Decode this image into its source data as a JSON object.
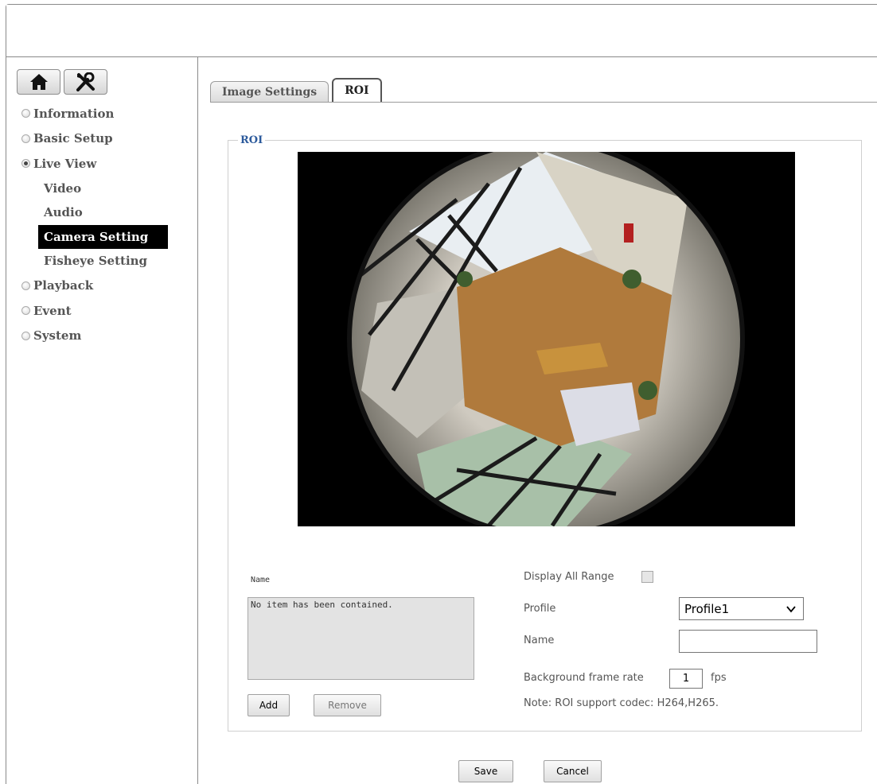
{
  "sidebar": {
    "toolbar": {
      "home_icon": "home-icon",
      "tools_icon": "tools-icon"
    },
    "menu": [
      {
        "label": "Information",
        "active": false
      },
      {
        "label": "Basic Setup",
        "active": false
      },
      {
        "label": "Live View",
        "active": true,
        "children": [
          {
            "label": "Video",
            "selected": false
          },
          {
            "label": "Audio",
            "selected": false
          },
          {
            "label": "Camera Setting",
            "selected": true
          },
          {
            "label": "Fisheye Setting",
            "selected": false
          }
        ]
      },
      {
        "label": "Playback",
        "active": false
      },
      {
        "label": "Event",
        "active": false
      },
      {
        "label": "System",
        "active": false
      }
    ]
  },
  "tabs": [
    {
      "label": "Image Settings",
      "active": false
    },
    {
      "label": "ROI",
      "active": true
    }
  ],
  "roi": {
    "legend": "ROI",
    "name_list_label": "Name",
    "name_list_empty": "No item has been contained.",
    "add_label": "Add",
    "remove_label": "Remove",
    "display_all_range_label": "Display All Range",
    "display_all_range_checked": false,
    "profile_label": "Profile",
    "profile_value": "Profile1",
    "name_label": "Name",
    "name_value": "",
    "bg_frame_rate_label": "Background frame rate",
    "bg_frame_rate_value": "1",
    "fps_label": "fps",
    "note": "Note: ROI support codec: H264,H265."
  },
  "footer": {
    "save_label": "Save",
    "cancel_label": "Cancel"
  },
  "colors": {
    "legend": "#2c5a9c",
    "selected_bg": "#000000",
    "floor": "#b07a3c"
  }
}
